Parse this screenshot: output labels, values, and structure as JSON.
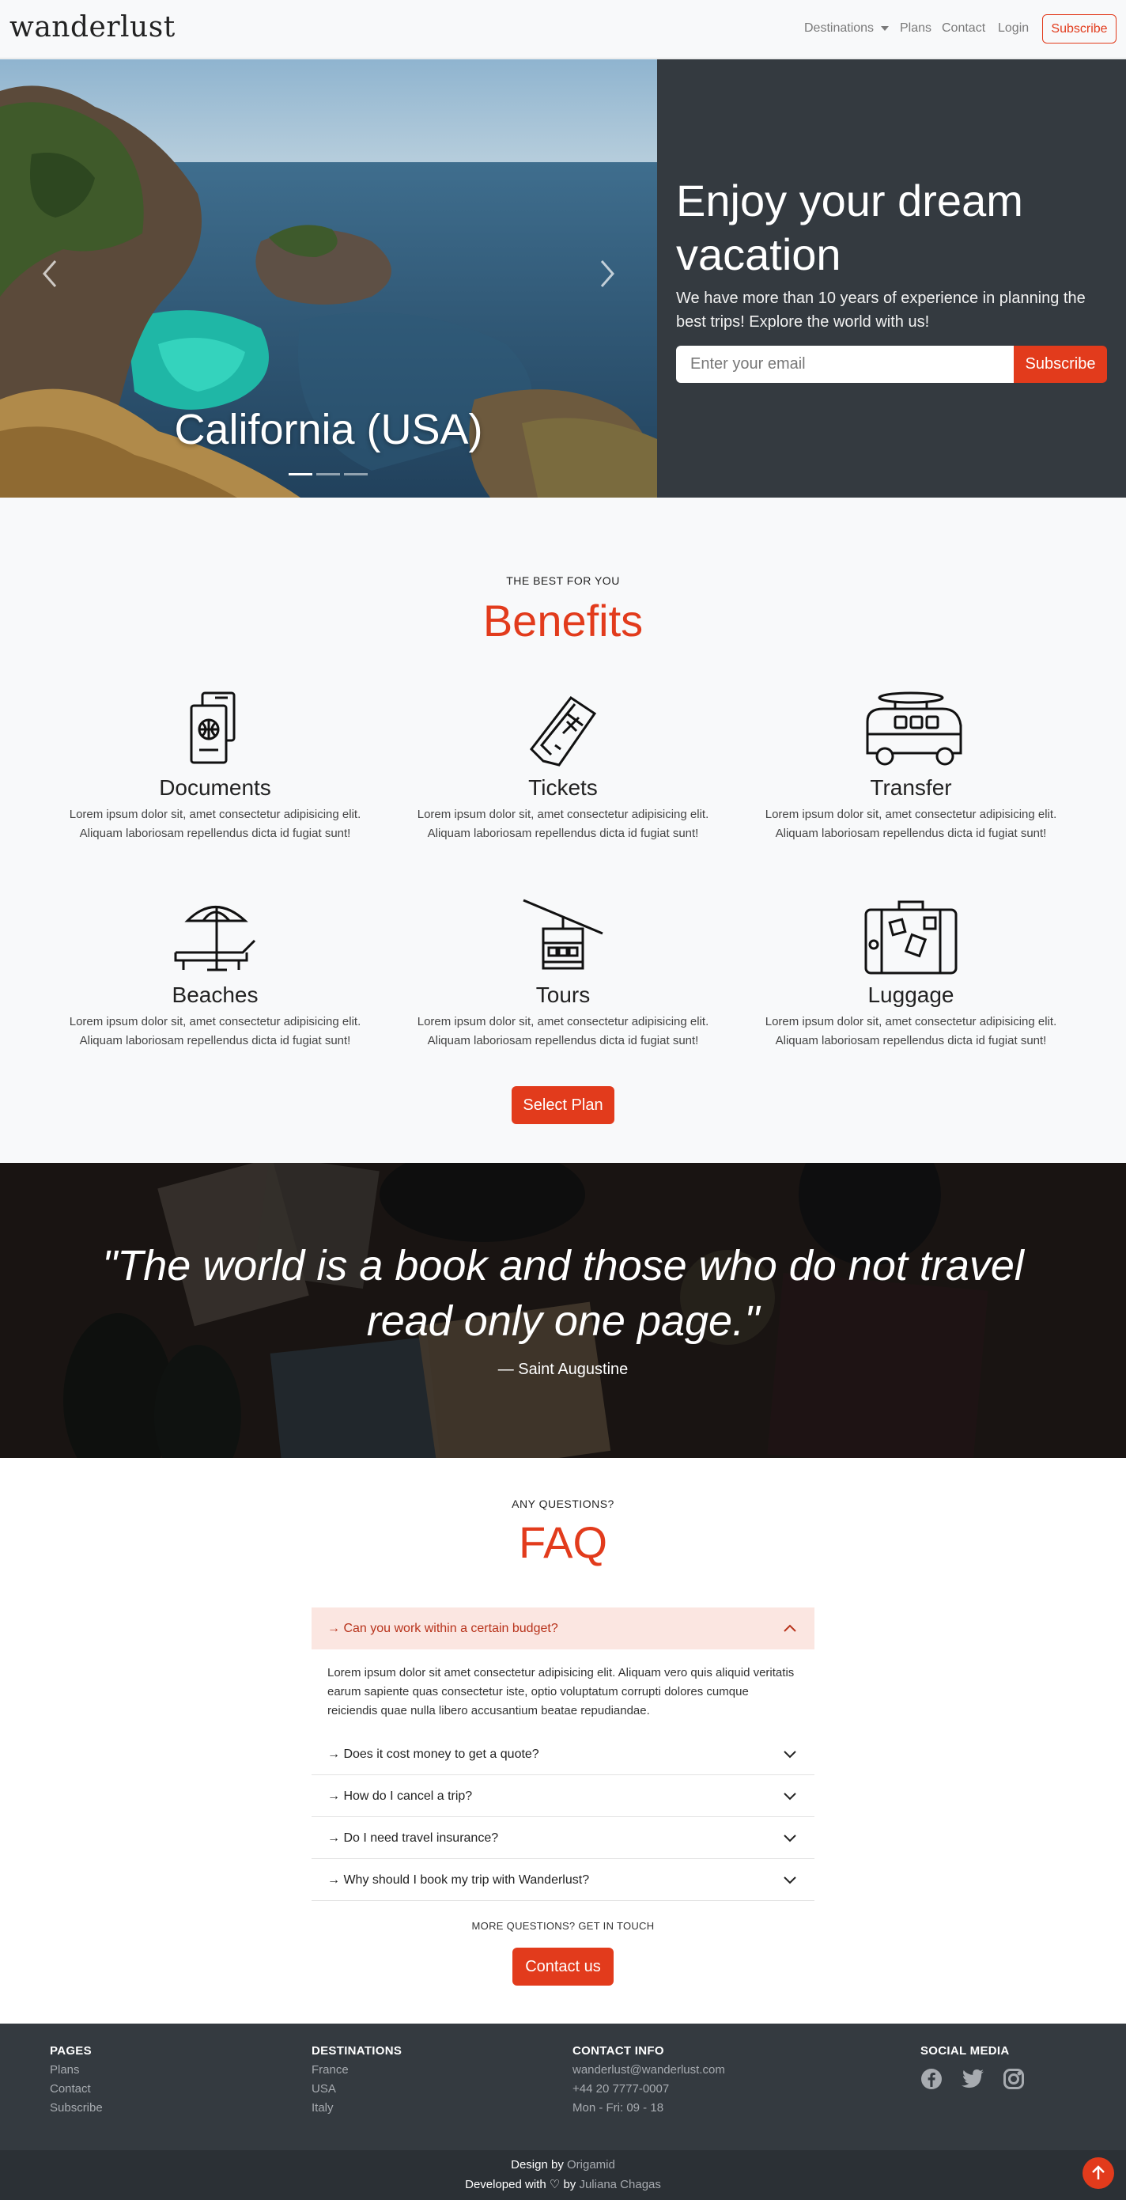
{
  "nav": {
    "brand": "wanderlust",
    "links": [
      "Destinations",
      "Plans",
      "Contact",
      "Login"
    ],
    "subscribe": "Subscribe"
  },
  "hero": {
    "caption": "California (USA)",
    "title": "Enjoy your dream vacation",
    "description": "We have more than 10 years of experience in planning the best trips! Explore the world with us!",
    "email_placeholder": "Enter your email",
    "subscribe": "Subscribe",
    "prev_icon": "chevron-left-icon",
    "next_icon": "chevron-right-icon"
  },
  "benefits": {
    "eyebrow": "THE BEST FOR YOU",
    "title": "Benefits",
    "items": [
      {
        "icon": "passport-icon",
        "title": "Documents",
        "text": "Lorem ipsum dolor sit, amet consectetur adipisicing elit. Aliquam laboriosam repellendus dicta id fugiat sunt!"
      },
      {
        "icon": "tickets-icon",
        "title": "Tickets",
        "text": "Lorem ipsum dolor sit, amet consectetur adipisicing elit. Aliquam laboriosam repellendus dicta id fugiat sunt!"
      },
      {
        "icon": "van-icon",
        "title": "Transfer",
        "text": "Lorem ipsum dolor sit, amet consectetur adipisicing elit. Aliquam laboriosam repellendus dicta id fugiat sunt!"
      },
      {
        "icon": "beach-umbrella-icon",
        "title": "Beaches",
        "text": "Lorem ipsum dolor sit, amet consectetur adipisicing elit. Aliquam laboriosam repellendus dicta id fugiat sunt!"
      },
      {
        "icon": "cable-car-icon",
        "title": "Tours",
        "text": "Lorem ipsum dolor sit, amet consectetur adipisicing elit. Aliquam laboriosam repellendus dicta id fugiat sunt!"
      },
      {
        "icon": "suitcase-icon",
        "title": "Luggage",
        "text": "Lorem ipsum dolor sit, amet consectetur adipisicing elit. Aliquam laboriosam repellendus dicta id fugiat sunt!"
      }
    ],
    "cta": "Select Plan"
  },
  "quote": {
    "text": "\"The world is a book and those who do not travel read only one page.\"",
    "author": "— Saint Augustine"
  },
  "faq": {
    "eyebrow": "ANY QUESTIONS?",
    "title": "FAQ",
    "open_question": "→ Can you work within a certain budget?",
    "open_answer": "Lorem ipsum dolor sit amet consectetur adipisicing elit. Aliquam vero quis aliquid veritatis earum sapiente quas consectetur iste, optio voluptatum corrupti dolores cumque reiciendis quae nulla libero accusantium beatae repudiandae.",
    "questions": [
      "→ Does it cost money to get a quote?",
      "→ How do I cancel a trip?",
      "→ Do I need travel insurance?",
      "→ Why should I book my trip with Wanderlust?"
    ],
    "more": "MORE QUESTIONS? GET IN TOUCH",
    "contact": "Contact us"
  },
  "footer": {
    "pages": {
      "heading": "PAGES",
      "links": [
        "Plans",
        "Contact",
        "Subscribe"
      ]
    },
    "destinations": {
      "heading": "DESTINATIONS",
      "links": [
        "France",
        "USA",
        "Italy"
      ]
    },
    "contact": {
      "heading": "CONTACT INFO",
      "lines": [
        "wanderlust@wanderlust.com",
        "+44 20 7777-0007",
        "Mon - Fri: 09 - 18"
      ]
    },
    "social": {
      "heading": "SOCIAL MEDIA",
      "icons": [
        "facebook-icon",
        "twitter-icon",
        "instagram-icon"
      ]
    },
    "design_by": "Design by",
    "design_name": "Origamid",
    "developed_with": "Developed with ♡ by",
    "developer": "Juliana Chagas"
  },
  "colors": {
    "accent": "#e23b1c",
    "dark": "#343a40",
    "light": "#f8f9fa"
  }
}
